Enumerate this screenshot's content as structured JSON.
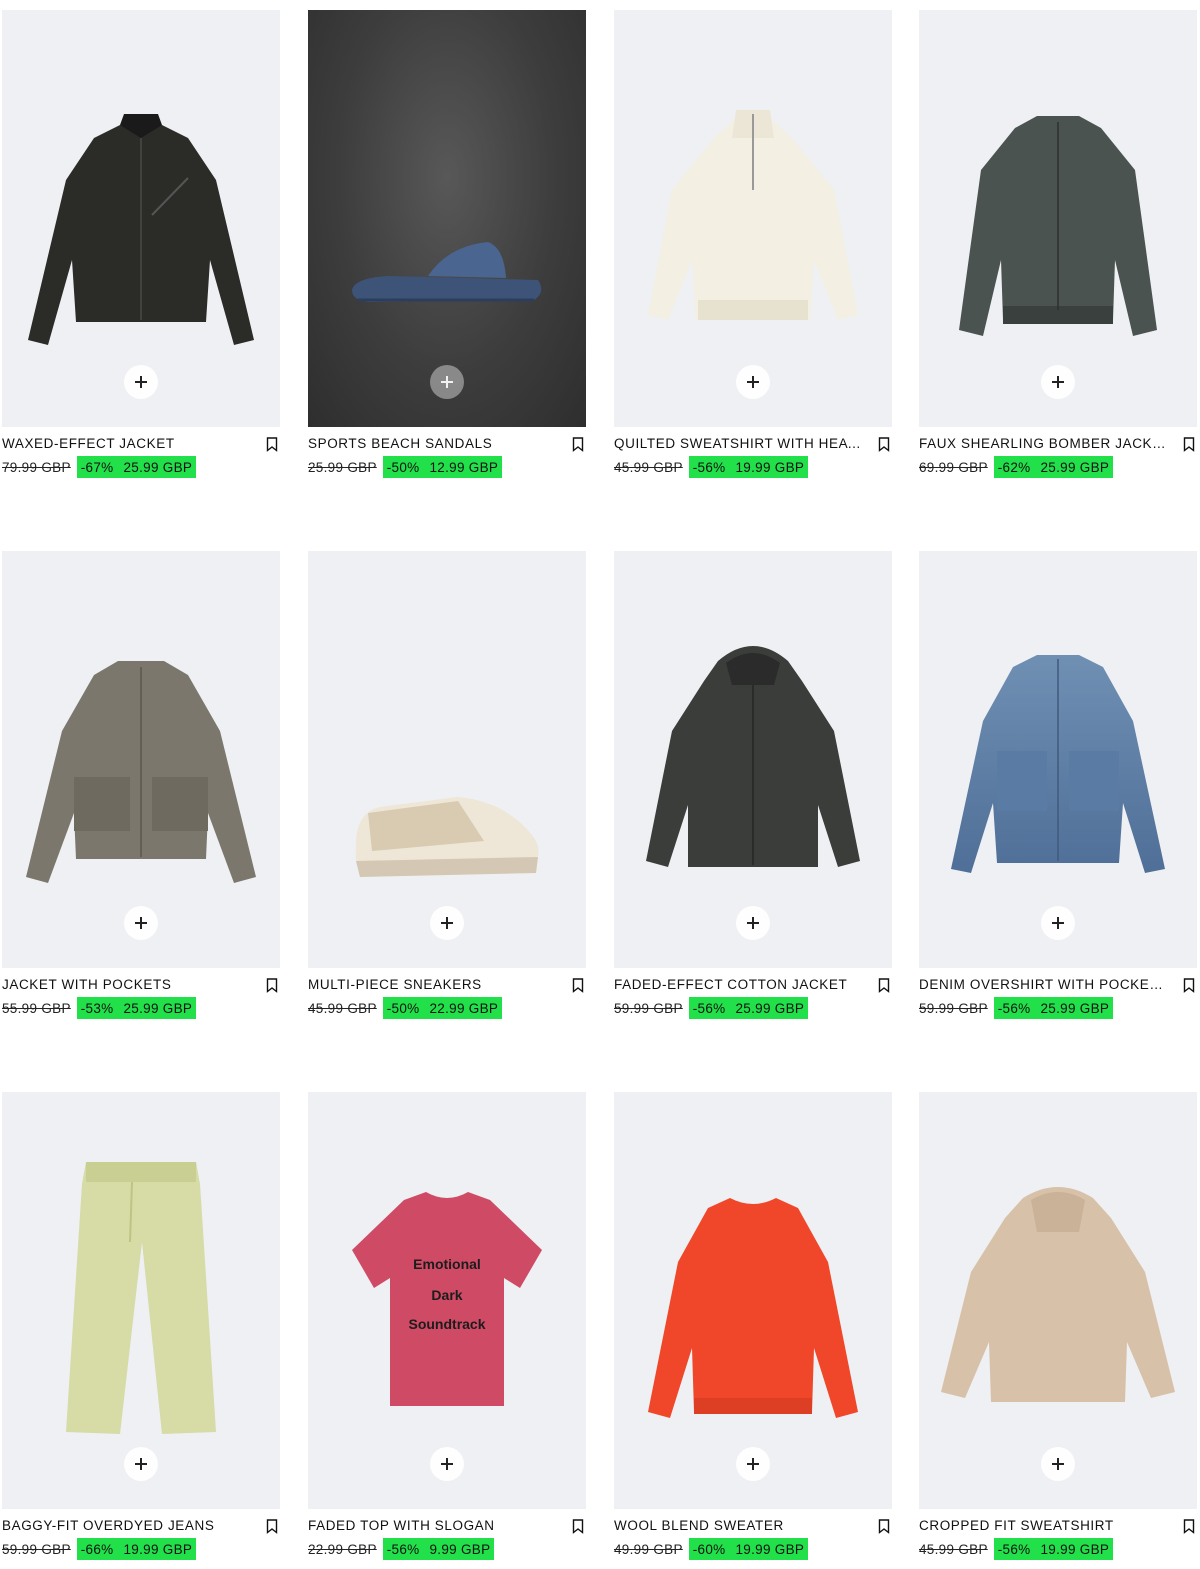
{
  "products": [
    {
      "name": "WAXED-EFFECT JACKET",
      "old_price": "79.99 GBP",
      "discount": "-67%",
      "price": "25.99 GBP",
      "image": "black-jacket",
      "bg": "light"
    },
    {
      "name": "SPORTS BEACH SANDALS",
      "old_price": "25.99 GBP",
      "discount": "-50%",
      "price": "12.99 GBP",
      "image": "navy-slide-sandal",
      "bg": "dark"
    },
    {
      "name": "QUILTED SWEATSHIRT WITH HEAT...",
      "old_price": "45.99 GBP",
      "discount": "-56%",
      "price": "19.99 GBP",
      "image": "cream-half-zip",
      "bg": "light"
    },
    {
      "name": "FAUX SHEARLING BOMBER JACKET",
      "old_price": "69.99 GBP",
      "discount": "-62%",
      "price": "25.99 GBP",
      "image": "charcoal-bomber",
      "bg": "light"
    },
    {
      "name": "JACKET WITH POCKETS",
      "old_price": "55.99 GBP",
      "discount": "-53%",
      "price": "25.99 GBP",
      "image": "khaki-jacket",
      "bg": "light"
    },
    {
      "name": "MULTI-PIECE SNEAKERS",
      "old_price": "45.99 GBP",
      "discount": "-50%",
      "price": "22.99 GBP",
      "image": "beige-sneaker",
      "bg": "light"
    },
    {
      "name": "FADED-EFFECT COTTON JACKET",
      "old_price": "59.99 GBP",
      "discount": "-56%",
      "price": "25.99 GBP",
      "image": "grey-hooded-jacket",
      "bg": "light"
    },
    {
      "name": "DENIM OVERSHIRT WITH POCKETS",
      "old_price": "59.99 GBP",
      "discount": "-56%",
      "price": "25.99 GBP",
      "image": "denim-overshirt",
      "bg": "light"
    },
    {
      "name": "BAGGY-FIT OVERDYED JEANS",
      "old_price": "59.99 GBP",
      "discount": "-66%",
      "price": "19.99 GBP",
      "image": "yellow-jeans",
      "bg": "light"
    },
    {
      "name": "FADED TOP WITH SLOGAN",
      "old_price": "22.99 GBP",
      "discount": "-56%",
      "price": "9.99 GBP",
      "image": "pink-tshirt",
      "bg": "light",
      "print_text": [
        "Emotional",
        "Dark",
        "Soundtrack"
      ]
    },
    {
      "name": "WOOL BLEND SWEATER",
      "old_price": "49.99 GBP",
      "discount": "-60%",
      "price": "19.99 GBP",
      "image": "orange-sweater",
      "bg": "light"
    },
    {
      "name": "CROPPED FIT SWEATSHIRT",
      "old_price": "45.99 GBP",
      "discount": "-56%",
      "price": "19.99 GBP",
      "image": "beige-hoodie",
      "bg": "light"
    }
  ],
  "icons": {
    "add": "plus-icon",
    "save": "bookmark-icon"
  },
  "colors": {
    "sale_highlight": "#22e04a",
    "image_bg": "#eef0f3"
  }
}
